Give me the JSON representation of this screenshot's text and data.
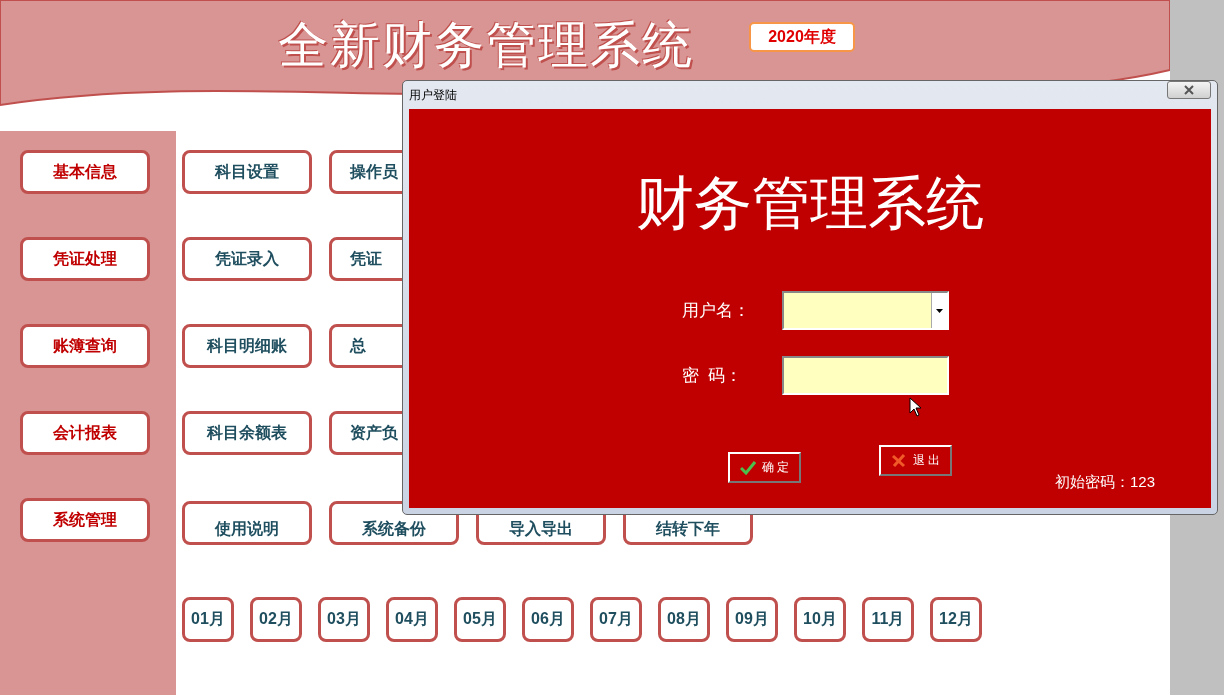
{
  "header": {
    "title": "全新财务管理系统",
    "year_badge": "2020年度"
  },
  "sidebar": {
    "items": [
      {
        "label": "基本信息"
      },
      {
        "label": "凭证处理"
      },
      {
        "label": "账簿查询"
      },
      {
        "label": "会计报表"
      },
      {
        "label": "系统管理"
      }
    ]
  },
  "function_rows": [
    [
      "科目设置",
      "操作员"
    ],
    [
      "凭证录入",
      "凭证"
    ],
    [
      "科目明细账",
      "总"
    ],
    [
      "科目余额表",
      "资产负"
    ],
    [
      "使用说明",
      "系统备份",
      "导入导出",
      "结转下年"
    ]
  ],
  "months": [
    "01月",
    "02月",
    "03月",
    "04月",
    "05月",
    "06月",
    "07月",
    "08月",
    "09月",
    "10月",
    "11月",
    "12月"
  ],
  "login_dialog": {
    "title": "用户登陆",
    "heading": "财务管理系统",
    "fields": [
      {
        "label": "用户名：",
        "kind": "dropdown"
      },
      {
        "label": "密  码：",
        "kind": "password"
      }
    ],
    "buttons": [
      {
        "label": "确 定",
        "kind": "confirm"
      },
      {
        "label": "退 出",
        "kind": "exit"
      }
    ],
    "hint": "初始密码：123"
  }
}
